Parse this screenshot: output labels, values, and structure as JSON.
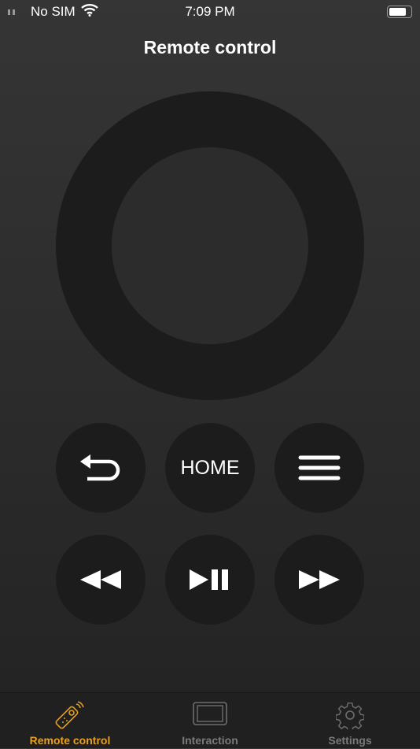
{
  "status": {
    "carrier": "No SIM",
    "time": "7:09 PM",
    "battery_level": 0.8
  },
  "header": {
    "title": "Remote control"
  },
  "remote": {
    "home_label": "HOME",
    "buttons": [
      "back",
      "home",
      "menu",
      "rewind",
      "play-pause",
      "fast-forward"
    ]
  },
  "tabbar": {
    "active": "Remote control",
    "accent": "#e8a020",
    "inactive_color": "#7a7a7a",
    "tabs": [
      {
        "label": "Remote control",
        "icon": "remote-icon"
      },
      {
        "label": "Interaction",
        "icon": "screen-icon"
      },
      {
        "label": "Settings",
        "icon": "gear-icon"
      }
    ]
  }
}
